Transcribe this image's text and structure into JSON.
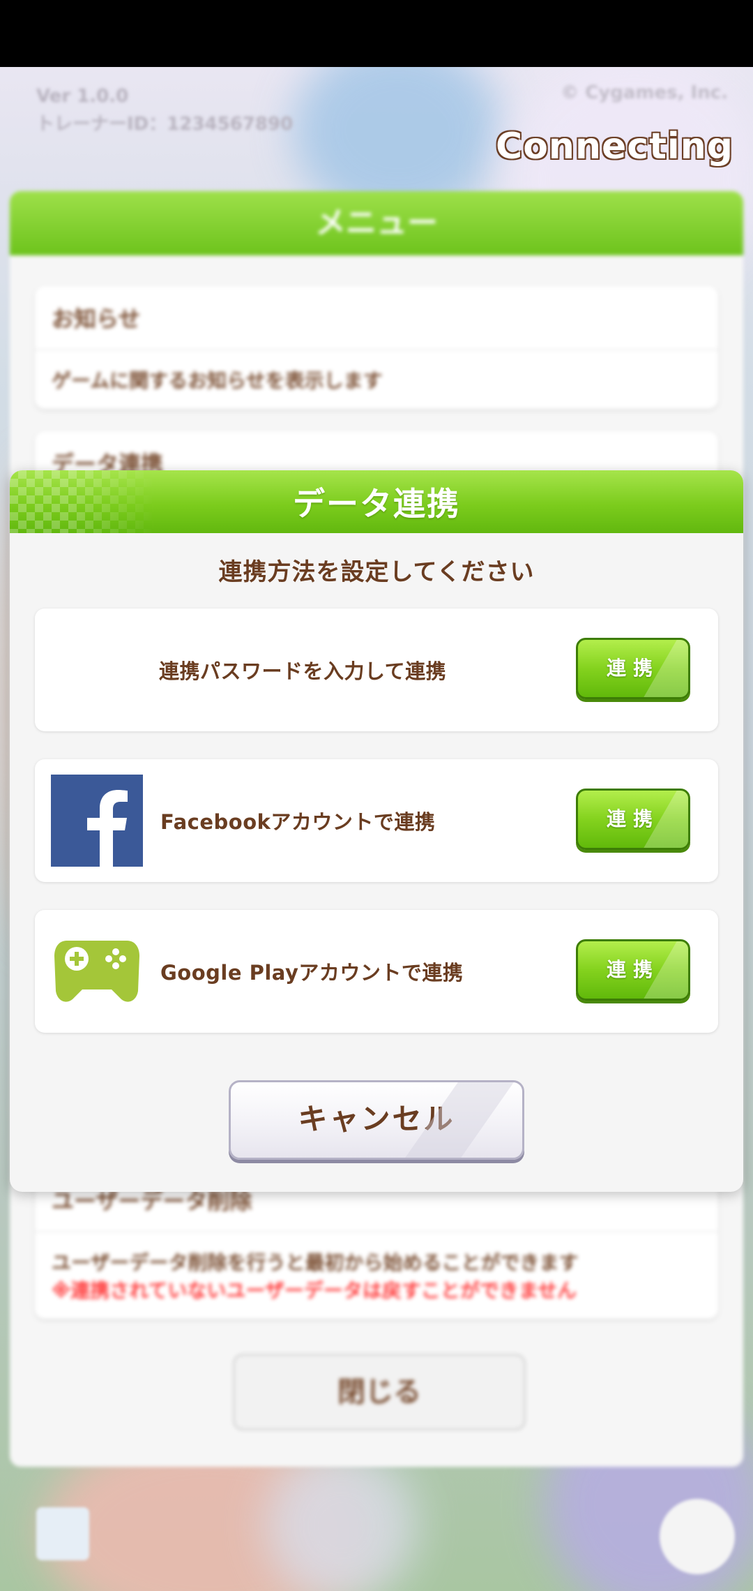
{
  "background": {
    "info_line1": "Ver 1.0.0",
    "info_line2": "トレーナーID：1234567890",
    "copyright": "© Cygames, Inc.",
    "connecting": "Connecting",
    "menu_title": "メニュー",
    "cards": [
      {
        "title": "お知らせ",
        "desc": "ゲームに関するお知らせを表示します"
      },
      {
        "title": "データ連携",
        "desc": ""
      },
      {
        "title": "ユーザーデータ削除",
        "desc": "ユーザーデータ削除を行うと最初から始めることができます",
        "warning": "※連携されていないユーザーデータは戻すことができません"
      }
    ],
    "close_label": "閉じる"
  },
  "dialog": {
    "title": "データ連携",
    "subtitle": "連携方法を設定してください",
    "options": [
      {
        "label": "連携パスワードを入力して連携",
        "button": "連携",
        "icon": "none"
      },
      {
        "label": "Facebookアカウントで連携",
        "button": "連携",
        "icon": "facebook-icon"
      },
      {
        "label": "Google Playアカウントで連携",
        "button": "連携",
        "icon": "google-play-games-icon"
      }
    ],
    "cancel_label": "キャンセル"
  },
  "colors": {
    "header_green": "#7ccc1d",
    "text_brown": "#6a3d21",
    "facebook_blue": "#3b5998",
    "games_green": "#a4c639"
  }
}
